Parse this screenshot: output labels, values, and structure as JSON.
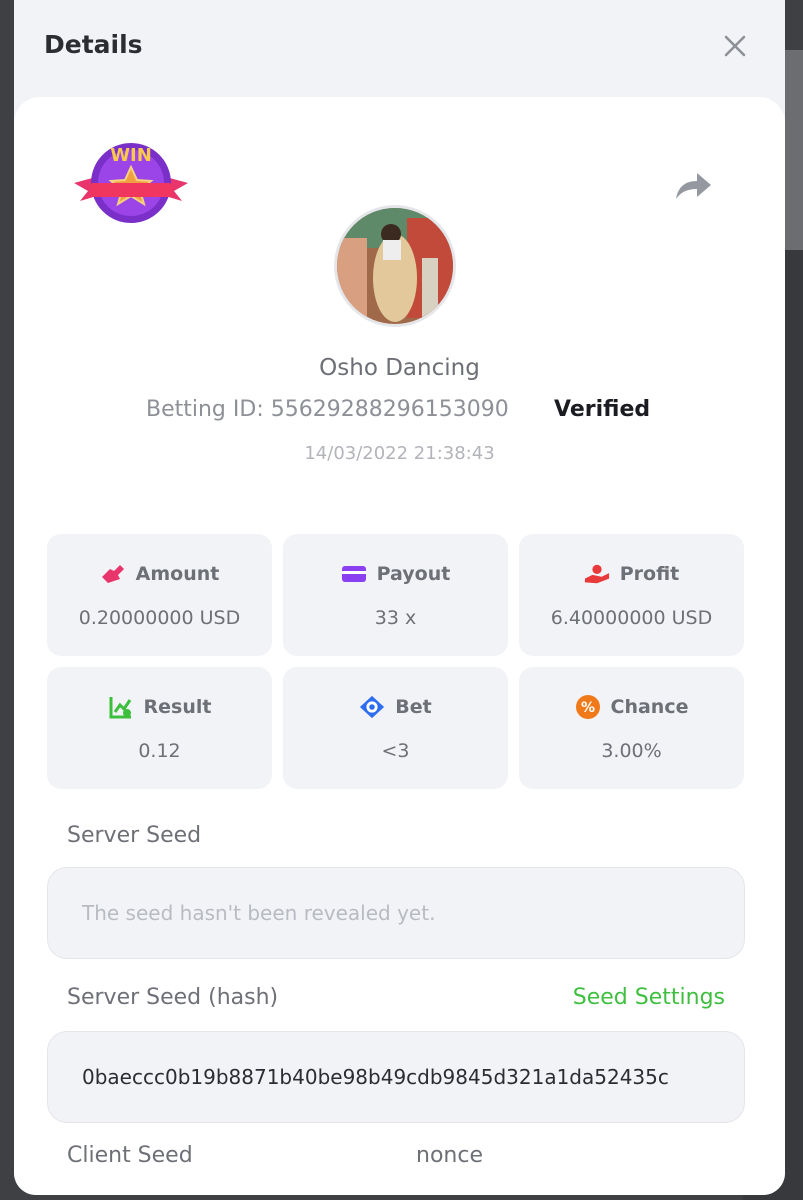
{
  "modal": {
    "title": "Details",
    "close_icon": "close-icon"
  },
  "bet": {
    "badge_text": "WIN",
    "game_name": "Osho Dancing",
    "betting_id_label": "Betting ID:",
    "betting_id": "55629288296153090",
    "verified_label": "Verified",
    "timestamp": "14/03/2022 21:38:43"
  },
  "stats": [
    {
      "label": "Amount",
      "value": "0.20000000 USD",
      "icon": "amount-icon",
      "color": "#e8356b"
    },
    {
      "label": "Payout",
      "value": "33 x",
      "icon": "payout-card-icon",
      "color": "#8a3ff0"
    },
    {
      "label": "Profit",
      "value": "6.40000000 USD",
      "icon": "profit-hand-icon",
      "color": "#e83a3a"
    },
    {
      "label": "Result",
      "value": "0.12",
      "icon": "result-chart-icon",
      "color": "#3cbf3c"
    },
    {
      "label": "Bet",
      "value": "<3",
      "icon": "bet-dice-icon",
      "color": "#2f6df0"
    },
    {
      "label": "Chance",
      "value": "3.00%",
      "icon": "chance-percent-icon",
      "color": "#f07a1a"
    }
  ],
  "server_seed": {
    "label": "Server Seed",
    "placeholder": "The seed hasn't been revealed yet."
  },
  "server_seed_hash": {
    "label": "Server Seed (hash)",
    "link": "Seed Settings",
    "value": "0baeccc0b19b8871b40be98b49cdb9845d321a1da52435c"
  },
  "client_seed": {
    "label": "Client Seed"
  },
  "nonce": {
    "label": "nonce"
  }
}
